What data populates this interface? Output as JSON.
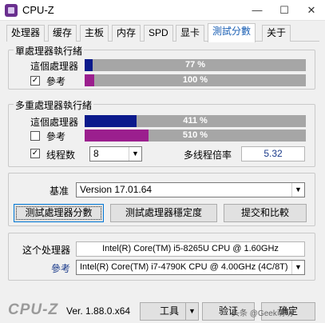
{
  "window": {
    "title": "CPU-Z",
    "minimize": "—",
    "maximize": "☐",
    "close": "✕"
  },
  "tabs": [
    "处理器",
    "缓存",
    "主板",
    "内存",
    "SPD",
    "显卡",
    "測試分數",
    "关于"
  ],
  "single_thread": {
    "title": "單處理器執行緒",
    "this_label": "這個處理器",
    "this_value": "77 %",
    "this_fraction": 0.035,
    "ref_label": "參考",
    "ref_value": "100 %",
    "ref_fraction": 0.045
  },
  "multi_thread": {
    "title": "多重處理器執行緒",
    "this_label": "這個處理器",
    "this_value": "411 %",
    "this_fraction": 0.235,
    "ref_label": "參考",
    "ref_value": "510 %",
    "ref_fraction": 0.29,
    "threads_label": "线程数",
    "threads_value": "8",
    "ratio_label": "多线程倍率",
    "ratio_value": "5.32"
  },
  "baseline": {
    "label": "基准",
    "value": "Version 17.01.64"
  },
  "buttons": {
    "bench": "测試處理器分數",
    "stress": "测試處理器穩定度",
    "submit": "提交和比較"
  },
  "processor": {
    "this_label": "这个处理器",
    "this_value": "Intel(R) Core(TM) i5-8265U CPU @ 1.60GHz",
    "ref_label": "參考",
    "ref_value": "Intel(R) Core(TM) i7-4790K CPU @ 4.00GHz (4C/8T)"
  },
  "footer": {
    "logo": "CPU-Z",
    "version": "Ver. 1.88.0.x64",
    "tools": "工具",
    "validate": "验证",
    "ok": "确定",
    "watermark": "头条 @Geek萌萌"
  },
  "colors": {
    "this_bar": "#0b1a8c",
    "ref_bar": "#9b1f8e",
    "track": "#a6a6a6",
    "active_tab": "#1a5fb4"
  }
}
